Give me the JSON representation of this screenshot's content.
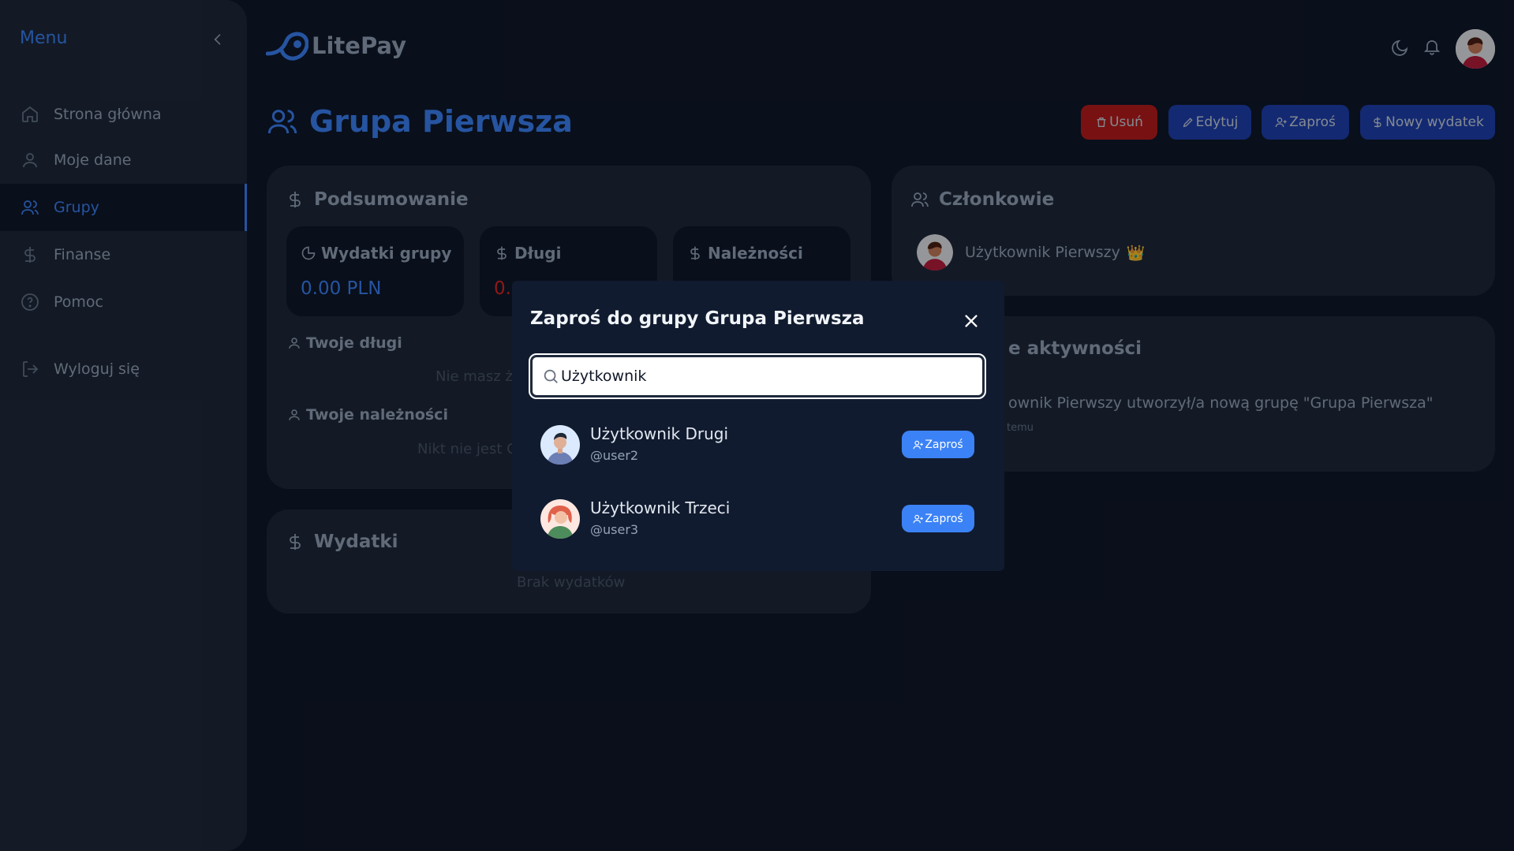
{
  "sidebar": {
    "title": "Menu",
    "items": [
      {
        "label": "Strona główna",
        "icon": "home-icon"
      },
      {
        "label": "Moje dane",
        "icon": "user-icon"
      },
      {
        "label": "Grupy",
        "icon": "users-icon"
      },
      {
        "label": "Finanse",
        "icon": "dollar-icon"
      },
      {
        "label": "Pomoc",
        "icon": "help-icon"
      },
      {
        "label": "Wyloguj się",
        "icon": "logout-icon"
      }
    ]
  },
  "header": {
    "app_name": "LitePay",
    "page_title": "Grupa Pierwsza",
    "actions": {
      "delete": "Usuń",
      "edit": "Edytuj",
      "invite": "Zaproś",
      "new_expense": "Nowy wydatek"
    }
  },
  "summary": {
    "title": "Podsumowanie",
    "group_expenses_label": "Wydatki grupy",
    "group_expenses_value": "0.00 PLN",
    "debts_label": "Długi",
    "debts_value": "0.",
    "receivables_label": "Należności",
    "your_debts_label": "Twoje długi",
    "your_debts_empty": "Nie masz ż",
    "your_receivables_label": "Twoje należności",
    "your_receivables_empty": "Nikt nie jest C"
  },
  "expenses": {
    "title": "Wydatki",
    "empty": "Brak wydatków"
  },
  "members": {
    "title": "Członkowie",
    "list": [
      {
        "name": "Użytkownik Pierwszy",
        "badge": "👑"
      }
    ]
  },
  "activity": {
    "title": "e aktywności",
    "entry_text": "ownik Pierwszy utworzył/a nową grupę \"Grupa Pierwsza\"",
    "entry_time": "temu"
  },
  "modal": {
    "title": "Zaproś do grupy Grupa Pierwsza",
    "search_value": "Użytkownik",
    "users": [
      {
        "name": "Użytkownik Drugi",
        "handle": "@user2",
        "button": "Zaproś"
      },
      {
        "name": "Użytkownik Trzeci",
        "handle": "@user3",
        "button": "Zaproś"
      }
    ]
  },
  "colors": {
    "accent": "#3b82f6",
    "danger": "#b91c1c",
    "background": "#0f172a",
    "card": "#1e293b"
  }
}
